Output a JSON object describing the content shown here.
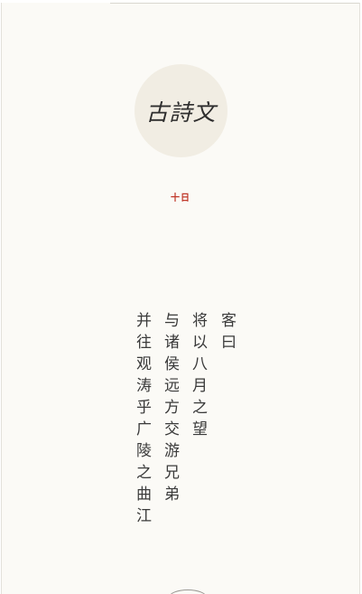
{
  "logo": {
    "title": "古詩文"
  },
  "date": {
    "label": "十日"
  },
  "poem": {
    "columns": [
      "客曰",
      "将以八月之望",
      "与诸侯远方交游兄弟",
      "并往观涛乎广陵之曲江"
    ]
  }
}
